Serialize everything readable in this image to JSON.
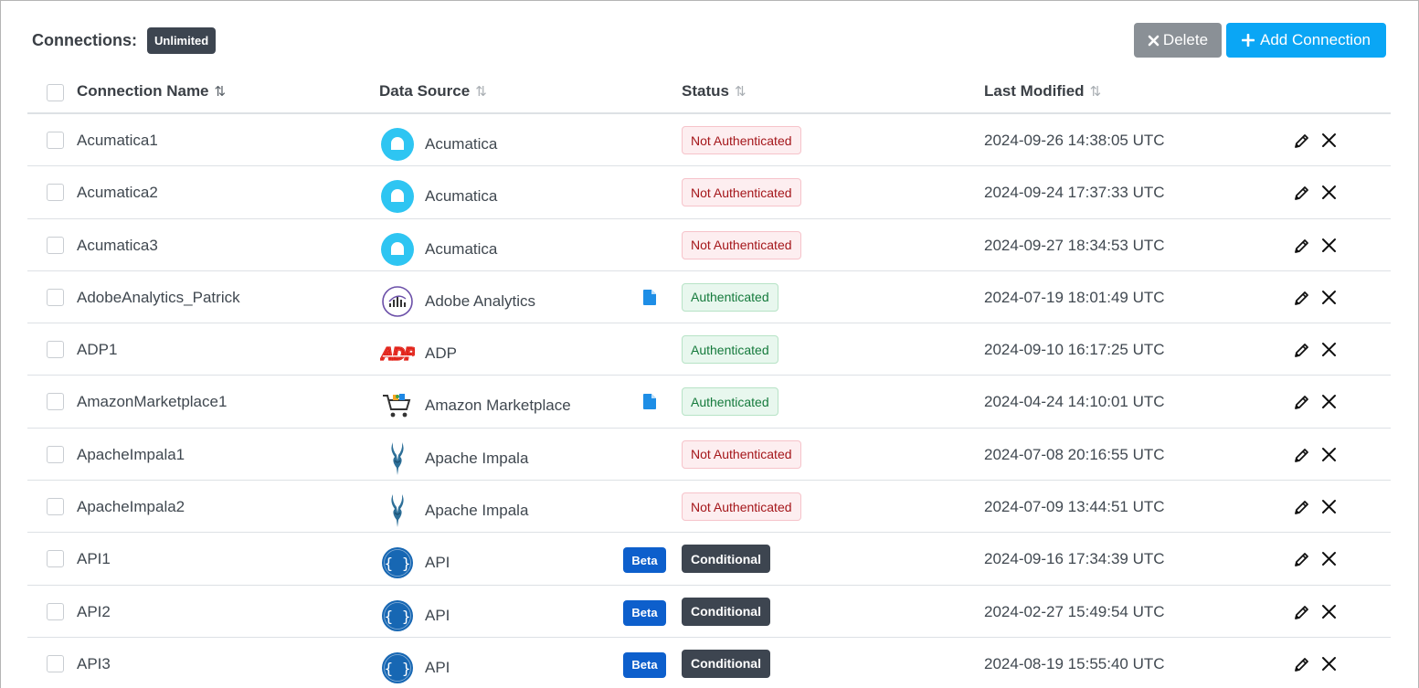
{
  "header": {
    "title": "Connections:",
    "plan_badge": "Unlimited"
  },
  "toolbar": {
    "delete_label": "Delete",
    "add_label": "Add Connection",
    "delete_color": "#8a9096",
    "add_color": "#0aa6f5"
  },
  "columns": {
    "name": "Connection Name",
    "source": "Data Source",
    "status": "Status",
    "modified": "Last Modified"
  },
  "status_colors": {
    "not_authenticated": "#a4161a",
    "authenticated": "#157a3c",
    "conditional": "#3d4550"
  },
  "rows": [
    {
      "name": "Acumatica1",
      "source": "Acumatica",
      "icon": "acumatica-icon",
      "status": "Not Authenticated",
      "status_type": "not",
      "modified": "2024-09-26 14:38:05 UTC",
      "doc": false,
      "beta": ""
    },
    {
      "name": "Acumatica2",
      "source": "Acumatica",
      "icon": "acumatica-icon",
      "status": "Not Authenticated",
      "status_type": "not",
      "modified": "2024-09-24 17:37:33 UTC",
      "doc": false,
      "beta": ""
    },
    {
      "name": "Acumatica3",
      "source": "Acumatica",
      "icon": "acumatica-icon",
      "status": "Not Authenticated",
      "status_type": "not",
      "modified": "2024-09-27 18:34:53 UTC",
      "doc": false,
      "beta": ""
    },
    {
      "name": "AdobeAnalytics_Patrick",
      "source": "Adobe Analytics",
      "icon": "adobe-analytics-icon",
      "status": "Authenticated",
      "status_type": "auth",
      "modified": "2024-07-19 18:01:49 UTC",
      "doc": true,
      "beta": ""
    },
    {
      "name": "ADP1",
      "source": "ADP",
      "icon": "adp-logo-icon",
      "status": "Authenticated",
      "status_type": "auth",
      "modified": "2024-09-10 16:17:25 UTC",
      "doc": false,
      "beta": ""
    },
    {
      "name": "AmazonMarketplace1",
      "source": "Amazon Marketplace",
      "icon": "shopping-cart-icon",
      "status": "Authenticated",
      "status_type": "auth",
      "modified": "2024-04-24 14:10:01 UTC",
      "doc": true,
      "beta": ""
    },
    {
      "name": "ApacheImpala1",
      "source": "Apache Impala",
      "icon": "apache-impala-icon",
      "status": "Not Authenticated",
      "status_type": "not",
      "modified": "2024-07-08 20:16:55 UTC",
      "doc": false,
      "beta": ""
    },
    {
      "name": "ApacheImpala2",
      "source": "Apache Impala",
      "icon": "apache-impala-icon",
      "status": "Not Authenticated",
      "status_type": "not",
      "modified": "2024-07-09 13:44:51 UTC",
      "doc": false,
      "beta": ""
    },
    {
      "name": "API1",
      "source": "API",
      "icon": "api-braces-icon",
      "status": "Conditional",
      "status_type": "cond",
      "modified": "2024-09-16 17:34:39 UTC",
      "doc": false,
      "beta": "Beta"
    },
    {
      "name": "API2",
      "source": "API",
      "icon": "api-braces-icon",
      "status": "Conditional",
      "status_type": "cond",
      "modified": "2024-02-27 15:49:54 UTC",
      "doc": false,
      "beta": "Beta"
    },
    {
      "name": "API3",
      "source": "API",
      "icon": "api-braces-icon",
      "status": "Conditional",
      "status_type": "cond",
      "modified": "2024-08-19 15:55:40 UTC",
      "doc": false,
      "beta": "Beta"
    }
  ]
}
